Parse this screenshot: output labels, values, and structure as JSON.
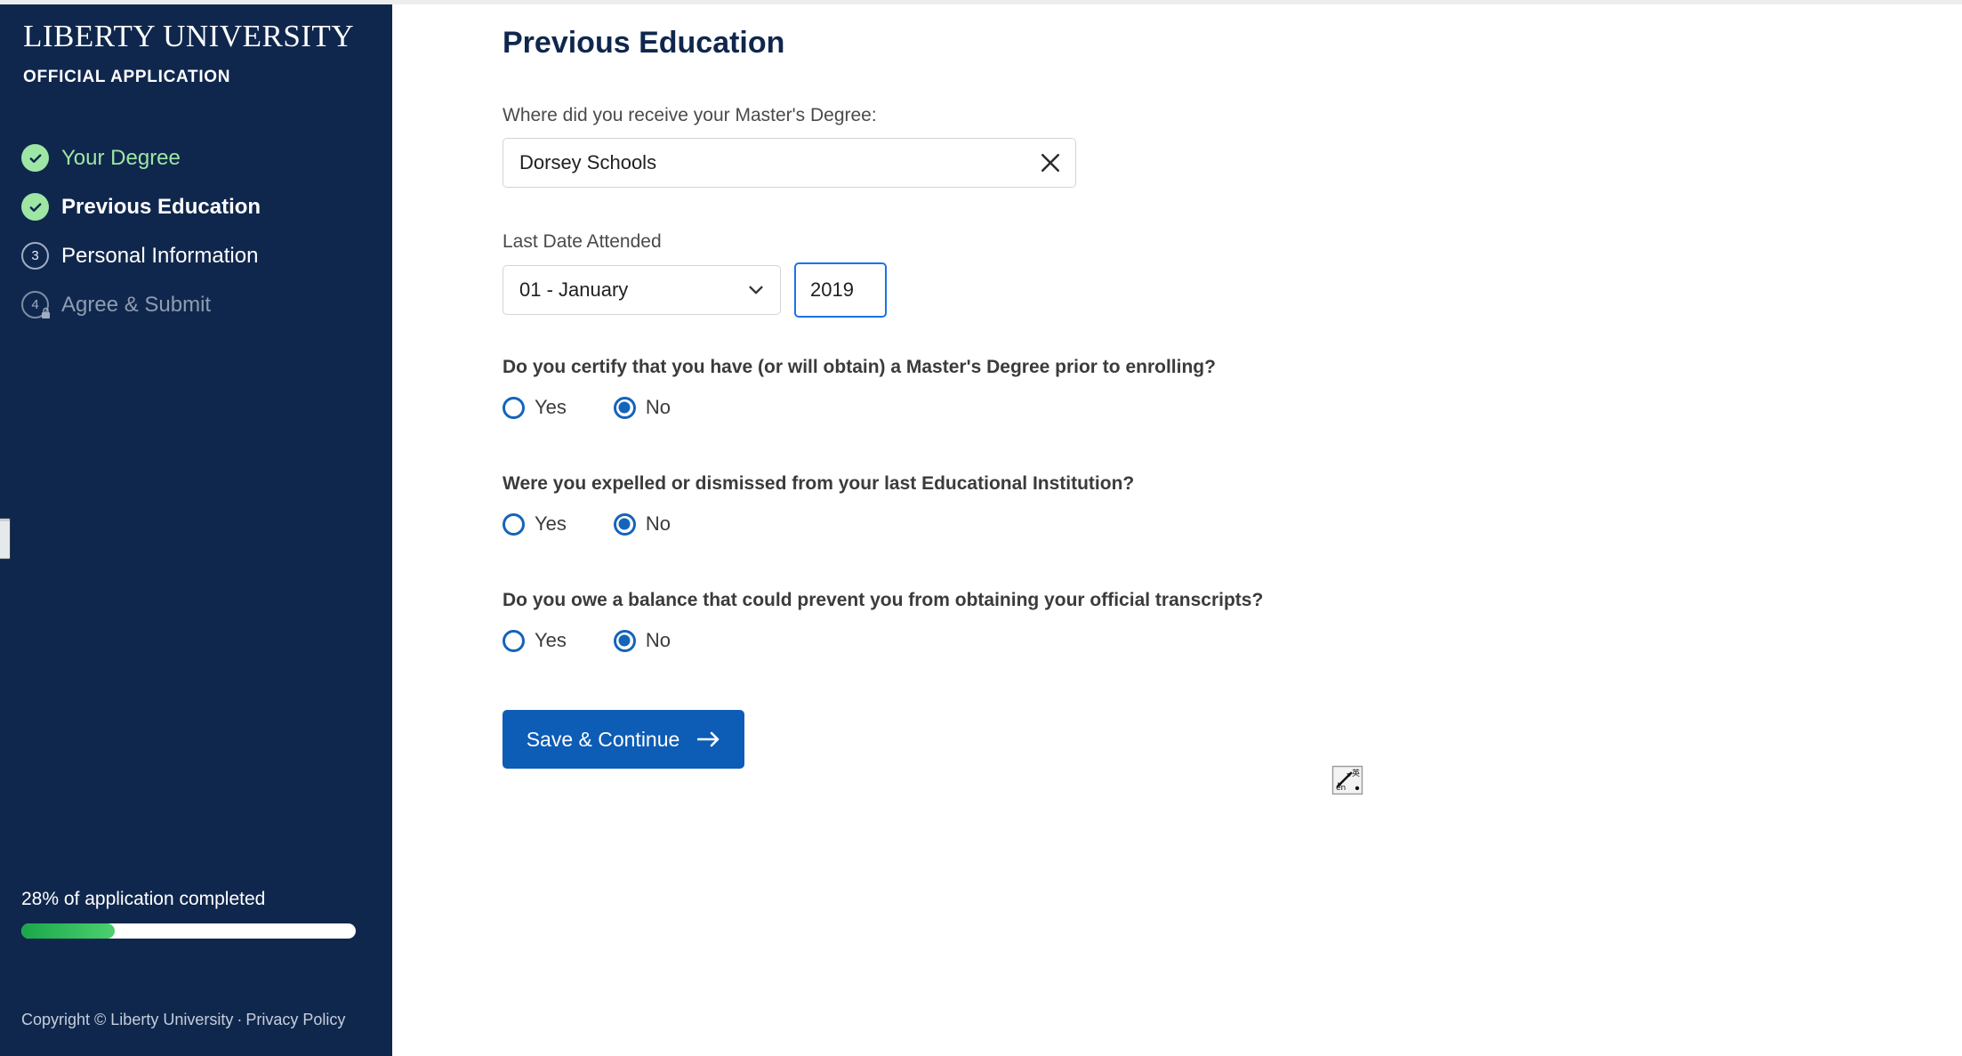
{
  "sidebar": {
    "brand": "LIBERTY UNIVERSITY",
    "subtitle": "OFFICIAL APPLICATION",
    "nav_items": [
      {
        "label": "Your Degree",
        "state": "completed",
        "badge": "check"
      },
      {
        "label": "Previous Education",
        "state": "current",
        "badge": "check"
      },
      {
        "label": "Personal Information",
        "state": "upcoming",
        "badge": "3"
      },
      {
        "label": "Agree & Submit",
        "state": "locked",
        "badge": "4"
      }
    ],
    "progress": {
      "text": "28% of application completed",
      "percent": 28
    },
    "footer": {
      "copyright": "Copyright © Liberty University",
      "separator": "·",
      "privacy_link": "Privacy Policy"
    }
  },
  "main": {
    "page_title": "Previous Education",
    "school_field": {
      "label": "Where did you receive your Master's Degree:",
      "value": "Dorsey Schools",
      "placeholder": "Search for a school"
    },
    "date_field": {
      "label": "Last Date Attended",
      "month_value": "01 - January",
      "year_value": "2019",
      "year_placeholder": "YYYY"
    },
    "questions": [
      {
        "text": "Do you certify that you have (or will obtain) a Master's Degree prior to enrolling?",
        "yes_label": "Yes",
        "no_label": "No",
        "selected": "No"
      },
      {
        "text": "Were you expelled or dismissed from your last Educational Institution?",
        "yes_label": "Yes",
        "no_label": "No",
        "selected": "No"
      },
      {
        "text": "Do you owe a balance that could prevent you from obtaining your official transcripts?",
        "yes_label": "Yes",
        "no_label": "No",
        "selected": "No"
      }
    ],
    "submit_button": "Save & Continue"
  },
  "colors": {
    "sidebar_bg": "#10274d",
    "accent_green": "#9ee6a4",
    "progress_green": "#4cd06e",
    "button_blue": "#0d5cb6",
    "focus_blue": "#1a73e8",
    "radio_blue": "#1464ba"
  }
}
